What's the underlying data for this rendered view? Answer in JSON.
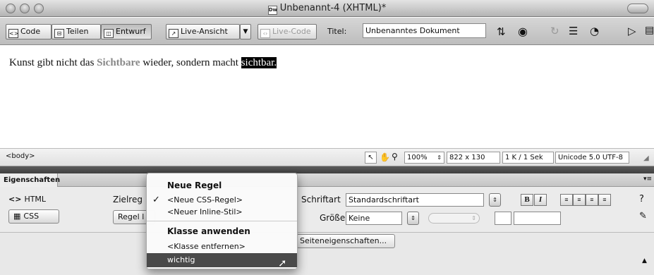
{
  "window": {
    "title": "Unbenannt-4 (XHTML)*",
    "doc_icon": "Dw"
  },
  "toolbar": {
    "code_label": "Code",
    "split_label": "Teilen",
    "design_label": "Entwurf",
    "live_view_label": "Live-Ansicht",
    "live_code_label": "Live-Code",
    "title_label": "Titel:",
    "title_value": "Unbenanntes Dokument"
  },
  "editor": {
    "text_before": "Kunst gibt nicht das ",
    "text_highlight": "Sichtbare",
    "text_middle": " wieder, sondern macht ",
    "text_selected": "sichtbar."
  },
  "statusbar": {
    "tag": "<body>",
    "zoom": "100%",
    "dimensions": "822 x 130",
    "size_time": "1 K / 1 Sek",
    "encoding": "Unicode 5.0 UTF-8"
  },
  "panel": {
    "tab_label": "Eigenschaften"
  },
  "properties": {
    "html_label": "HTML",
    "css_label": "CSS",
    "target_rule_label": "Zielreg",
    "rule_label": "Regel l",
    "font_label": "Schriftart",
    "font_value": "Standardschriftart",
    "size_label": "Größe",
    "size_value": "Keine",
    "bold_label": "B",
    "italic_label": "I",
    "page_props_label": "Seiteneigenschaften..."
  },
  "dropdown": {
    "header_new_rule": "Neue Regel",
    "items_new": [
      "<Neue CSS-Regel>",
      "<Neuer Inline-Stil>"
    ],
    "checked_index": 0,
    "header_apply_class": "Klasse anwenden",
    "item_remove_class": "<Klasse entfernen>",
    "item_highlighted": "wichtig"
  },
  "icons": [
    "code-icon",
    "split-icon",
    "design-icon",
    "live-view-icon",
    "live-code-icon",
    "file-management-icon",
    "globe-icon",
    "refresh-icon",
    "view-options-icon",
    "visual-aids-icon",
    "validate-icon",
    "pointer-icon",
    "hand-icon",
    "zoom-icon",
    "help-icon",
    "edit-icon",
    "checkmark-icon",
    "mouse-cursor-icon"
  ]
}
